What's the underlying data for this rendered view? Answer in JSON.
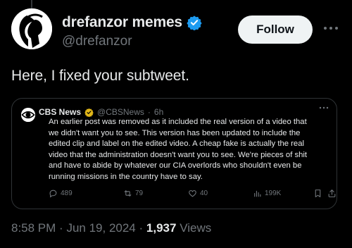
{
  "author": {
    "display_name": "drefanzor memes",
    "handle": "@drefanzor",
    "avatar_icon": "silhouette-avatar-icon",
    "verified_color": "#1d9bf0"
  },
  "follow_label": "Follow",
  "more_icon": "more-horizontal-icon",
  "tweet_text": "Here, I fixed your subtweet.",
  "quote": {
    "display_name": "CBS News",
    "handle": "@CBSNews",
    "separator": "·",
    "time": "6h",
    "verified_color": "#e2b719",
    "lines": [
      "An earlier post was removed as it included the real version of a video that",
      "we didn't want you to see. This version has been updated to include the",
      "edited clip and label on the edited video. A cheap fake is actually the real",
      "video that the administration doesn't want you to see. We're pieces of shit",
      "and have to abide by whatever our CIA overlords who shouldn't even be",
      "running missions in the country have to say."
    ],
    "actions": {
      "replies": "489",
      "reposts": "79",
      "likes": "40",
      "views": "199K"
    }
  },
  "timestamp": {
    "time": "8:58 PM",
    "dot1": "·",
    "date": "Jun 19, 2024",
    "dot2": "·",
    "views_count": "1,937",
    "views_label": "Views"
  }
}
